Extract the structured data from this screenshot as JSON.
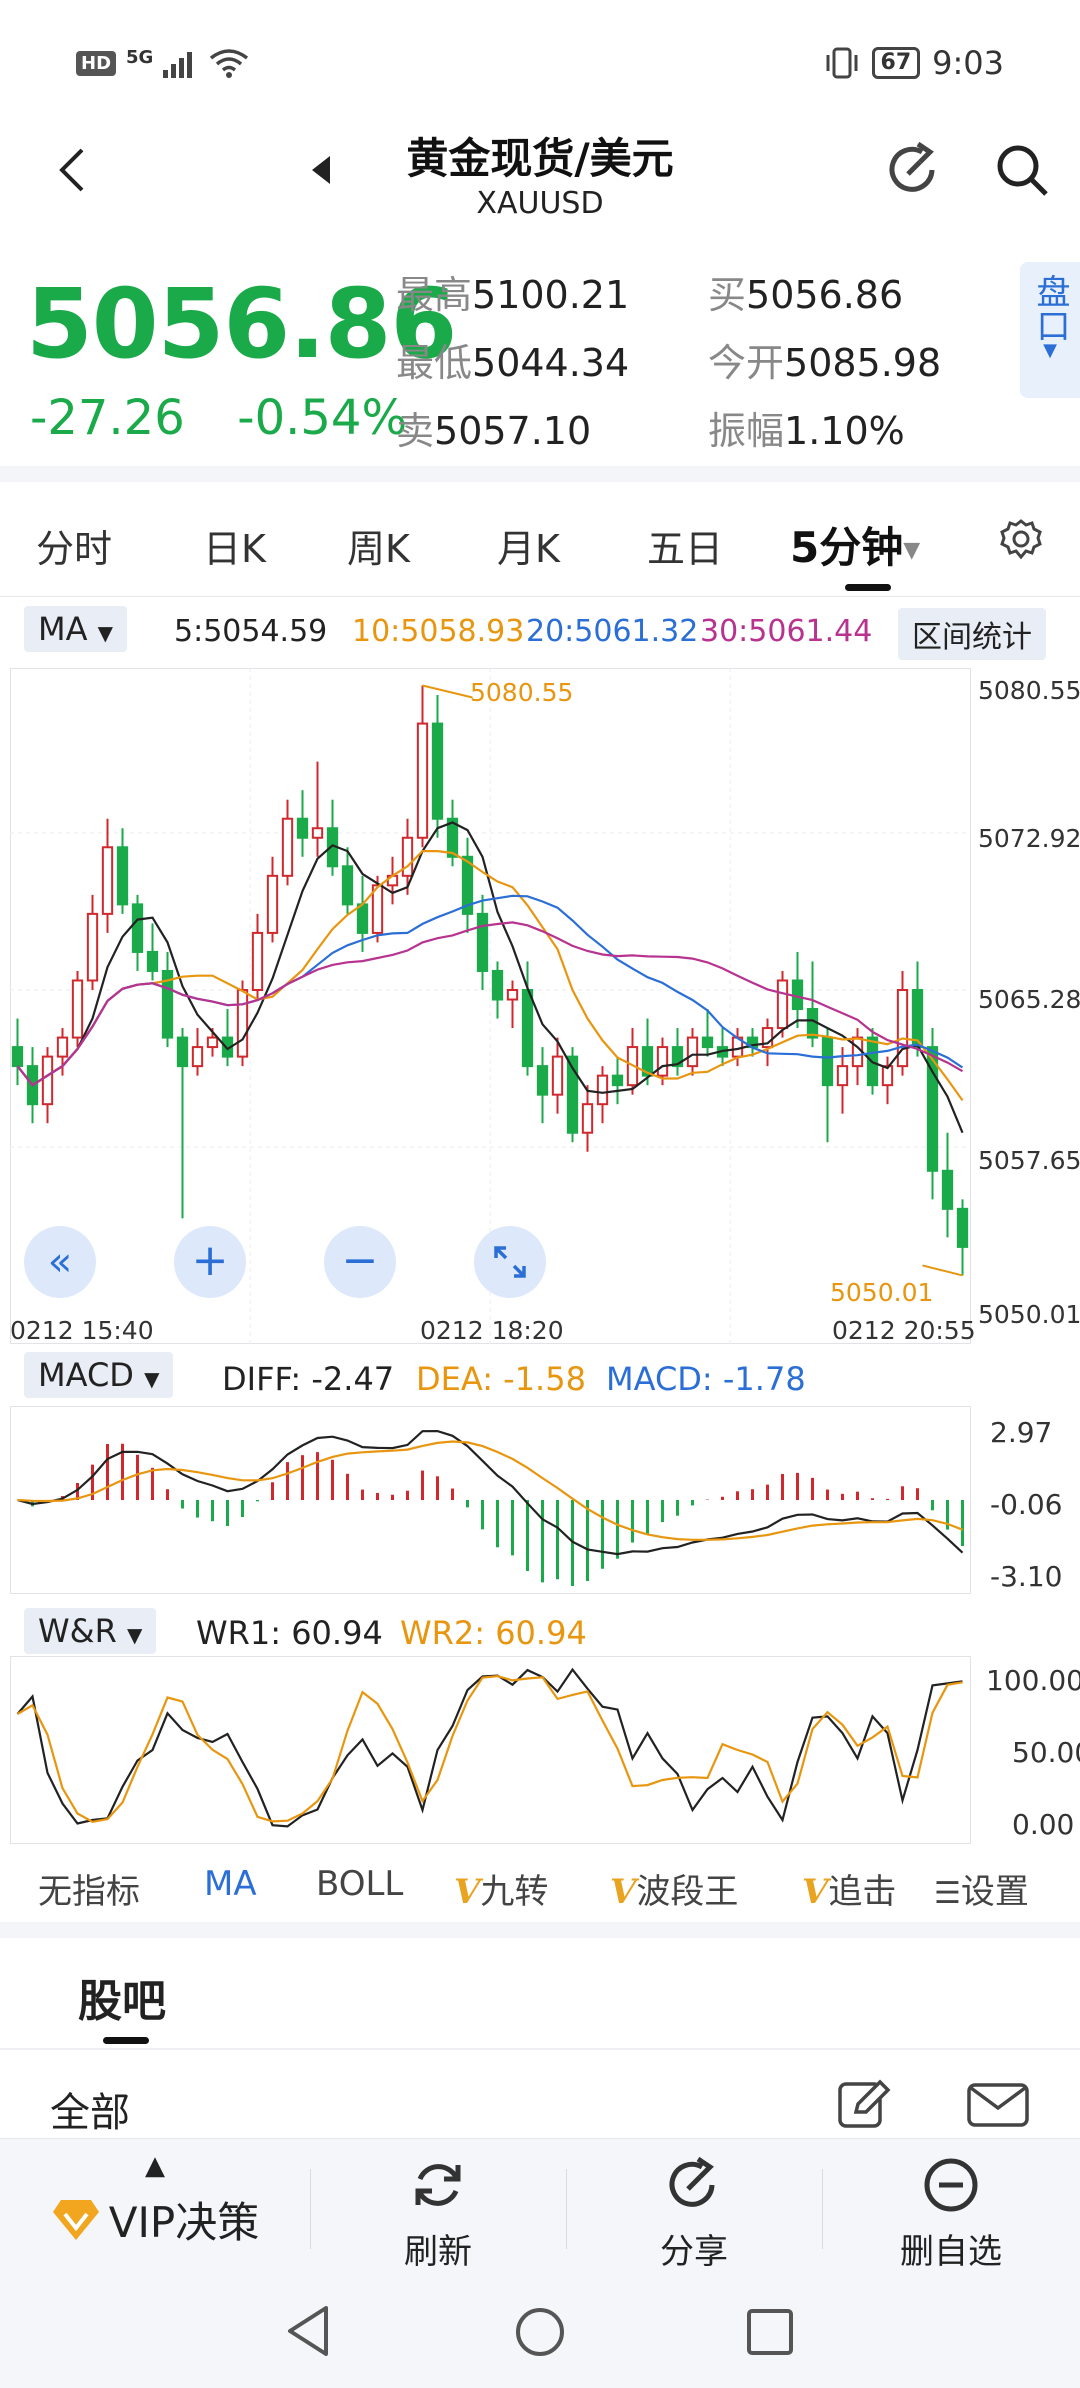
{
  "status_bar": {
    "hd": "HD",
    "network": "5G",
    "battery": "67",
    "time": "9:03"
  },
  "header": {
    "title": "黄金现货/美元",
    "symbol": "XAUUSD"
  },
  "quote": {
    "price": "5056.86",
    "change": "-27.26",
    "change_pct": "-0.54%",
    "high_label": "最高",
    "high": "5100.21",
    "low_label": "最低",
    "low": "5044.34",
    "sell_label": "卖",
    "sell": "5057.10",
    "buy_label": "买",
    "buy": "5056.86",
    "open_label": "今开",
    "open": "5085.98",
    "amp_label": "振幅",
    "amp": "1.10%",
    "pankou": "盘口"
  },
  "tabs": [
    "分时",
    "日K",
    "周K",
    "月K",
    "五日",
    "5分钟"
  ],
  "ma_row": {
    "selector": "MA",
    "ma5": "5:5054.59",
    "ma10": "10:5058.93",
    "ma20": "20:5061.32",
    "ma30": "30:5061.44",
    "range_stat": "区间统计"
  },
  "colors": {
    "up": "#d0282c",
    "down": "#1aaa4a",
    "ma5": "#222222",
    "ma10": "#e8960f",
    "ma20": "#2b6fd6",
    "ma30": "#b8338f",
    "accent": "#2b6fd6"
  },
  "main_chart": {
    "y_labels": [
      "5080.55",
      "5072.92",
      "5065.28",
      "5057.65",
      "5050.01"
    ],
    "x_labels": [
      "0212  15:40",
      "0212  18:20",
      "0212  20:55"
    ],
    "max_marker": "5080.55",
    "min_marker": "5050.01"
  },
  "macd_row": {
    "selector": "MACD",
    "diff": "DIFF: -2.47",
    "dea": "DEA: -1.58",
    "macd": "MACD: -1.78",
    "y_labels": [
      "2.97",
      "-0.06",
      "-3.10"
    ]
  },
  "wr_row": {
    "selector": "W&R",
    "wr1": "WR1: 60.94",
    "wr2": "WR2: 60.94",
    "y_labels": [
      "100.00",
      "50.00",
      "0.00"
    ]
  },
  "indicator_tabs": {
    "none": "无指标",
    "ma": "MA",
    "boll": "BOLL",
    "jiuzhuan": "九转",
    "boduan": "波段王",
    "zhuiji": "追击",
    "settings": "设置",
    "v_mark": "V"
  },
  "guba": {
    "title": "股吧",
    "all": "全部"
  },
  "bottom_bar": {
    "vip": "VIP决策",
    "refresh": "刷新",
    "share": "分享",
    "remove": "删自选"
  },
  "chart_data": {
    "type": "candlestick",
    "interval": "5分钟",
    "ylim": [
      5048.5,
      5081.5
    ],
    "candles": [
      [
        5062.0,
        5063.5,
        5060.0,
        5061.0
      ],
      [
        5061.0,
        5062.0,
        5058.0,
        5059.0
      ],
      [
        5059.0,
        5062.0,
        5058.0,
        5061.5
      ],
      [
        5061.5,
        5063.0,
        5060.5,
        5062.5
      ],
      [
        5062.5,
        5066.0,
        5062.0,
        5065.5
      ],
      [
        5065.5,
        5070.0,
        5065.0,
        5069.0
      ],
      [
        5069.0,
        5074.0,
        5068.0,
        5072.5
      ],
      [
        5072.5,
        5073.5,
        5069.0,
        5069.5
      ],
      [
        5069.5,
        5070.0,
        5066.0,
        5067.0
      ],
      [
        5067.0,
        5068.5,
        5065.5,
        5066.0
      ],
      [
        5066.0,
        5067.0,
        5062.0,
        5062.5
      ],
      [
        5062.5,
        5063.0,
        5053.0,
        5061.0
      ],
      [
        5061.0,
        5063.0,
        5060.5,
        5062.0
      ],
      [
        5062.0,
        5063.0,
        5061.5,
        5062.5
      ],
      [
        5062.5,
        5064.0,
        5061.0,
        5061.5
      ],
      [
        5061.5,
        5065.5,
        5061.0,
        5065.0
      ],
      [
        5065.0,
        5069.0,
        5064.5,
        5068.0
      ],
      [
        5068.0,
        5072.0,
        5067.5,
        5071.0
      ],
      [
        5071.0,
        5075.0,
        5070.5,
        5074.0
      ],
      [
        5074.0,
        5075.5,
        5072.0,
        5073.0
      ],
      [
        5073.0,
        5077.0,
        5072.0,
        5073.5
      ],
      [
        5073.5,
        5075.0,
        5071.0,
        5071.5
      ],
      [
        5071.5,
        5072.5,
        5069.0,
        5069.5
      ],
      [
        5069.5,
        5071.0,
        5067.0,
        5068.0
      ],
      [
        5068.0,
        5071.0,
        5067.5,
        5070.5
      ],
      [
        5070.5,
        5072.0,
        5069.5,
        5071.0
      ],
      [
        5071.0,
        5074.0,
        5070.0,
        5073.0
      ],
      [
        5073.0,
        5081.0,
        5072.5,
        5079.0
      ],
      [
        5079.0,
        5080.5,
        5073.0,
        5074.0
      ],
      [
        5074.0,
        5075.0,
        5071.5,
        5072.0
      ],
      [
        5072.0,
        5073.0,
        5068.0,
        5069.0
      ],
      [
        5069.0,
        5070.0,
        5065.0,
        5066.0
      ],
      [
        5066.0,
        5066.5,
        5063.5,
        5064.5
      ],
      [
        5064.5,
        5065.5,
        5063.0,
        5065.0
      ],
      [
        5065.0,
        5066.5,
        5060.5,
        5061.0
      ],
      [
        5061.0,
        5062.0,
        5058.0,
        5059.5
      ],
      [
        5059.5,
        5062.5,
        5058.5,
        5061.5
      ],
      [
        5061.5,
        5062.0,
        5057.0,
        5057.5
      ],
      [
        5057.5,
        5060.0,
        5056.5,
        5059.0
      ],
      [
        5059.0,
        5061.0,
        5058.0,
        5060.5
      ],
      [
        5060.5,
        5061.5,
        5059.0,
        5060.0
      ],
      [
        5060.0,
        5063.0,
        5059.5,
        5062.0
      ],
      [
        5062.0,
        5063.5,
        5060.0,
        5060.5
      ],
      [
        5060.5,
        5062.5,
        5060.0,
        5062.0
      ],
      [
        5062.0,
        5063.0,
        5060.5,
        5061.0
      ],
      [
        5061.0,
        5063.0,
        5060.5,
        5062.5
      ],
      [
        5062.5,
        5064.0,
        5061.5,
        5062.0
      ],
      [
        5062.0,
        5063.0,
        5061.0,
        5061.5
      ],
      [
        5061.5,
        5063.0,
        5061.0,
        5062.5
      ],
      [
        5062.5,
        5063.0,
        5061.5,
        5062.0
      ],
      [
        5062.0,
        5063.5,
        5061.0,
        5063.0
      ],
      [
        5063.0,
        5066.0,
        5062.5,
        5065.5
      ],
      [
        5065.5,
        5067.0,
        5063.0,
        5064.0
      ],
      [
        5064.0,
        5066.5,
        5062.0,
        5062.5
      ],
      [
        5062.5,
        5063.0,
        5057.0,
        5060.0
      ],
      [
        5060.0,
        5062.0,
        5058.5,
        5061.0
      ],
      [
        5061.0,
        5063.0,
        5060.0,
        5062.5
      ],
      [
        5062.5,
        5063.0,
        5059.5,
        5060.0
      ],
      [
        5060.0,
        5061.5,
        5059.0,
        5061.0
      ],
      [
        5061.0,
        5066.0,
        5060.5,
        5065.0
      ],
      [
        5065.0,
        5066.5,
        5061.5,
        5062.0
      ],
      [
        5062.0,
        5063.0,
        5054.0,
        5055.5
      ],
      [
        5055.5,
        5057.5,
        5052.0,
        5053.5
      ],
      [
        5053.5,
        5054.0,
        5050.0,
        5051.5
      ]
    ]
  }
}
